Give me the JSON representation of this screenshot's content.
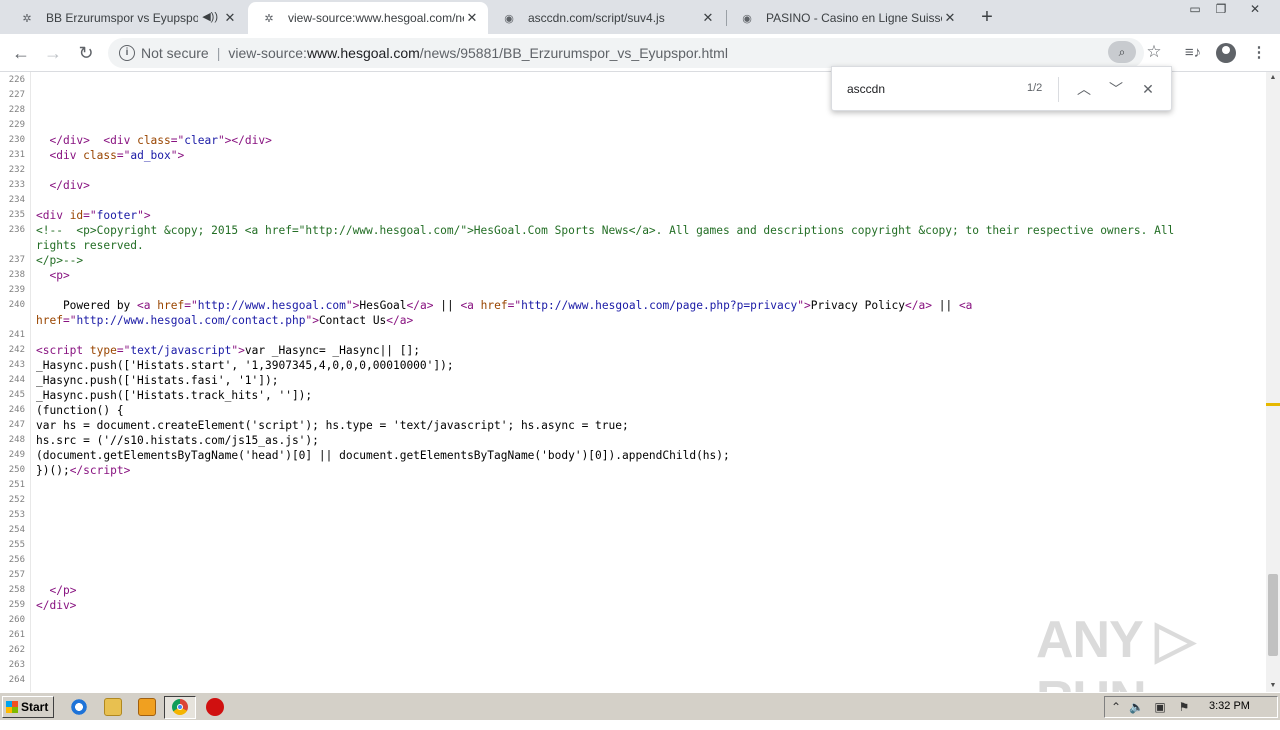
{
  "tabs": [
    {
      "title": "BB Erzurumspor vs Eyupspor - H",
      "has_audio": true
    },
    {
      "title": "view-source:www.hesgoal.com/new",
      "active": true
    },
    {
      "title": "asccdn.com/script/suv4.js"
    },
    {
      "title": "PASINO - Casino en Ligne Suisse - Si"
    }
  ],
  "toolbar": {
    "security_label": "Not secure",
    "url_prefix": "view-source:",
    "url_host": "www.hesgoal.com",
    "url_path": "/news/95881/BB_Erzurumspor_vs_Eyupspor.html"
  },
  "find": {
    "query": "asccdn",
    "count": "1/2"
  },
  "source_lines": [
    {
      "n": "226",
      "html": ""
    },
    {
      "n": "227",
      "html": ""
    },
    {
      "n": "228",
      "html": ""
    },
    {
      "n": "229",
      "html": ""
    },
    {
      "n": "230",
      "html": "  <span class=\"tag\">&lt;/div&gt;</span>  <span class=\"tag\">&lt;div </span><span class=\"attr\">class</span><span class=\"tag\">=\"</span><span class=\"val\">clear</span><span class=\"tag\">\"&gt;&lt;/div&gt;</span>"
    },
    {
      "n": "231",
      "html": "  <span class=\"tag\">&lt;div </span><span class=\"attr\">class</span><span class=\"tag\">=\"</span><span class=\"val\">ad_box</span><span class=\"tag\">\"&gt;</span>"
    },
    {
      "n": "232",
      "html": ""
    },
    {
      "n": "233",
      "html": "  <span class=\"tag\">&lt;/div&gt;</span>"
    },
    {
      "n": "234",
      "html": ""
    },
    {
      "n": "235",
      "html": "<span class=\"tag\">&lt;div </span><span class=\"attr\">id</span><span class=\"tag\">=\"</span><span class=\"val\">footer</span><span class=\"tag\">\"&gt;</span>"
    },
    {
      "n": "236",
      "html": "<span class=\"cmt\">&lt;!--  &lt;p&gt;Copyright &amp;copy; 2015 &lt;a href=\"http://www.hesgoal.com/\"&gt;HesGoal.Com Sports News&lt;/a&gt;. All games and descriptions copyright &amp;copy; to their respective owners. All</span>"
    },
    {
      "n": "",
      "html": "<span class=\"cmt\">rights reserved.</span>"
    },
    {
      "n": "237",
      "html": "<span class=\"cmt\">&lt;/p&gt;--&gt;</span>"
    },
    {
      "n": "238",
      "html": "  <span class=\"tag\">&lt;p&gt;</span>"
    },
    {
      "n": "239",
      "html": ""
    },
    {
      "n": "240",
      "html": "    Powered by <span class=\"tag\">&lt;a </span><span class=\"attr\">href</span><span class=\"tag\">=\"</span><span class=\"val\">http://www.hesgoal.com</span><span class=\"tag\">\"&gt;</span>HesGoal<span class=\"tag\">&lt;/a&gt;</span> || <span class=\"tag\">&lt;a </span><span class=\"attr\">href</span><span class=\"tag\">=\"</span><span class=\"val\">http://www.hesgoal.com/page.php?p=privacy</span><span class=\"tag\">\"&gt;</span>Privacy Policy<span class=\"tag\">&lt;/a&gt;</span> || <span class=\"tag\">&lt;a</span>"
    },
    {
      "n": "",
      "html": "<span class=\"attr\">href</span><span class=\"tag\">=\"</span><span class=\"val\">http://www.hesgoal.com/contact.php</span><span class=\"tag\">\"&gt;</span>Contact Us<span class=\"tag\">&lt;/a&gt;</span>"
    },
    {
      "n": "241",
      "html": ""
    },
    {
      "n": "242",
      "html": "<span class=\"tag\">&lt;script </span><span class=\"attr\">type</span><span class=\"tag\">=\"</span><span class=\"val\">text/javascript</span><span class=\"tag\">\"&gt;</span>var _Hasync= _Hasync|| [];"
    },
    {
      "n": "243",
      "html": "_Hasync.push(['Histats.start', '1,3907345,4,0,0,0,00010000']);"
    },
    {
      "n": "244",
      "html": "_Hasync.push(['Histats.fasi', '1']);"
    },
    {
      "n": "245",
      "html": "_Hasync.push(['Histats.track_hits', '']);"
    },
    {
      "n": "246",
      "html": "(function() {"
    },
    {
      "n": "247",
      "html": "var hs = document.createElement('script'); hs.type = 'text/javascript'; hs.async = true;"
    },
    {
      "n": "248",
      "html": "hs.src = ('//s10.histats.com/js15_as.js');"
    },
    {
      "n": "249",
      "html": "(document.getElementsByTagName('head')[0] || document.getElementsByTagName('body')[0]).appendChild(hs);"
    },
    {
      "n": "250",
      "html": "})();<span class=\"tag\">&lt;/script&gt;</span>"
    },
    {
      "n": "251",
      "html": ""
    },
    {
      "n": "252",
      "html": ""
    },
    {
      "n": "253",
      "html": ""
    },
    {
      "n": "254",
      "html": ""
    },
    {
      "n": "255",
      "html": ""
    },
    {
      "n": "256",
      "html": ""
    },
    {
      "n": "257",
      "html": ""
    },
    {
      "n": "258",
      "html": "  <span class=\"tag\">&lt;/p&gt;</span>"
    },
    {
      "n": "259",
      "html": "<span class=\"tag\">&lt;/div&gt;</span>"
    },
    {
      "n": "260",
      "html": ""
    },
    {
      "n": "261",
      "html": ""
    },
    {
      "n": "262",
      "html": ""
    },
    {
      "n": "263",
      "html": ""
    },
    {
      "n": "264",
      "html": ""
    }
  ],
  "watermark": "ANY RUN",
  "taskbar": {
    "start_label": "Start",
    "clock": "3:32 PM"
  }
}
